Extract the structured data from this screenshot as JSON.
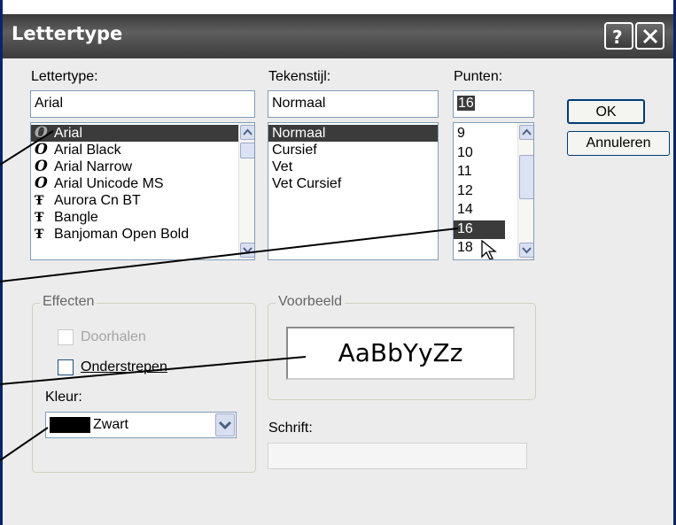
{
  "dialog": {
    "title": "Lettertype"
  },
  "font": {
    "label": "Lettertype:",
    "value": "Arial",
    "items": [
      "Arial",
      "Arial Black",
      "Arial Narrow",
      "Arial Unicode MS",
      "Aurora Cn BT",
      "Bangle",
      "Banjoman Open Bold"
    ]
  },
  "style": {
    "label": "Tekenstijl:",
    "value": "Normaal",
    "items": [
      "Normaal",
      "Cursief",
      "Vet",
      "Vet Cursief"
    ]
  },
  "size": {
    "label": "Punten:",
    "value": "16",
    "items": [
      "9",
      "10",
      "11",
      "12",
      "14",
      "16",
      "18"
    ]
  },
  "buttons": {
    "ok": "OK",
    "cancel": "Annuleren"
  },
  "effects": {
    "title": "Effecten",
    "strike": "Doorhalen",
    "underline": "Onderstrepen",
    "color_label": "Kleur:",
    "color_value": "Zwart",
    "color_swatch": "#000000"
  },
  "preview": {
    "title": "Voorbeeld",
    "sample": "AaBbYyZz"
  },
  "script": {
    "label": "Schrift:",
    "value": ""
  },
  "icons": {
    "truetype": "TT",
    "opentype": "O"
  }
}
